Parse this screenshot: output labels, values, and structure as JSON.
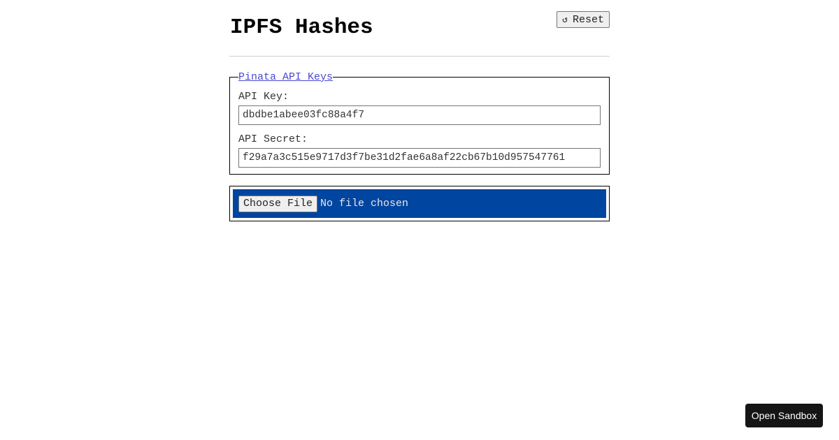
{
  "header": {
    "title": "IPFS Hashes",
    "reset_label": "Reset",
    "reset_icon": "undo-arrow-icon"
  },
  "api_keys": {
    "legend": "Pinata API Keys",
    "api_key_label": "API Key:",
    "api_key_value": "dbdbe1abee03fc88a4f7",
    "api_secret_label": "API Secret:",
    "api_secret_value": "f29a7a3c515e9717d3f7be31d2fae6a8af22cb67b10d957547761"
  },
  "upload": {
    "choose_label": "Choose File",
    "status": "No file chosen",
    "background_color": "#0046a0"
  },
  "sandbox": {
    "label": "Open Sandbox"
  }
}
